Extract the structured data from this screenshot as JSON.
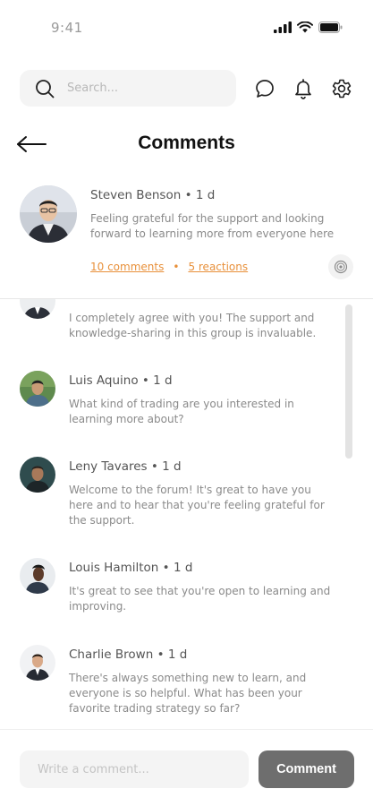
{
  "status_bar": {
    "time": "9:41"
  },
  "search": {
    "placeholder": "Search..."
  },
  "header": {
    "title": "Comments"
  },
  "post": {
    "author": "Steven Benson",
    "time": "1 d",
    "text": "Feeling grateful for the support and looking forward to learning more from everyone here",
    "comments_link": "10 comments",
    "separator": "•",
    "reactions_link": "5 reactions"
  },
  "comments": [
    {
      "author": "",
      "time": "",
      "text": "I completely agree with you! The support and knowledge-sharing in this group is invaluable."
    },
    {
      "author": "Luis Aquino",
      "time": "1 d",
      "text": "What kind of trading are you interested in learning more about?"
    },
    {
      "author": "Leny Tavares",
      "time": "1 d",
      "text": "Welcome to the forum! It's great to have you here and to hear that you're feeling grateful for the support."
    },
    {
      "author": "Louis Hamilton",
      "time": "1 d",
      "text": "It's great to see that you're open to learning and improving."
    },
    {
      "author": "Charlie Brown",
      "time": "1 d",
      "text": "There's always something new to learn, and everyone is so helpful. What has been your favorite trading strategy so far?"
    }
  ],
  "composer": {
    "placeholder": "Write a comment...",
    "button_label": "Comment"
  },
  "icons": {
    "search": "search-icon",
    "chat": "chat-bubble-icon",
    "notifications": "bell-icon",
    "settings": "gear-icon",
    "back": "arrow-left-icon",
    "reaction": "reaction-icon"
  },
  "colors": {
    "accent": "#e8903a",
    "button": "#6e6e6e",
    "title": "#111111"
  }
}
